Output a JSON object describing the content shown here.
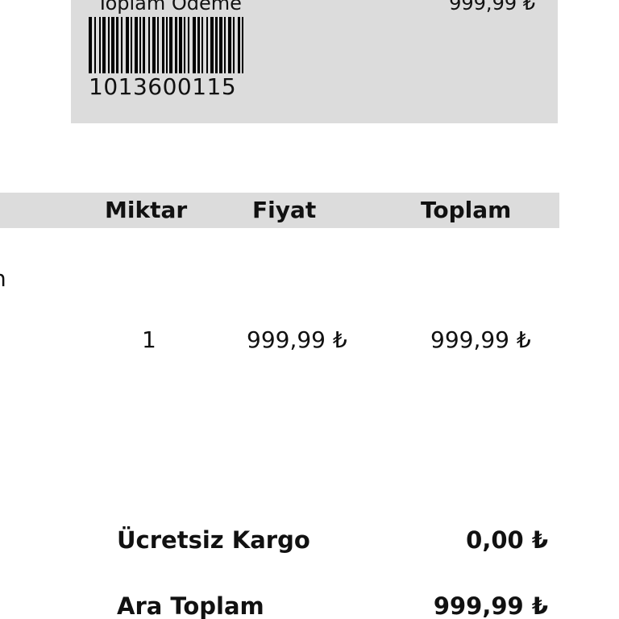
{
  "payment_summary": {
    "label": "Toplam Ödeme",
    "value": "999,99 ₺",
    "barcode_number": "1013600115"
  },
  "table": {
    "headers": {
      "quantity": "Miktar",
      "price": "Fiyat",
      "total": "Toplam"
    },
    "rows": [
      {
        "name_fragment": "n",
        "quantity": "1",
        "price": "999,99 ₺",
        "total": "999,99 ₺"
      }
    ]
  },
  "summary": {
    "shipping_label": "Ücretsiz Kargo",
    "shipping_value": "0,00 ₺",
    "subtotal_label": "Ara Toplam",
    "subtotal_value": "999,99 ₺"
  }
}
